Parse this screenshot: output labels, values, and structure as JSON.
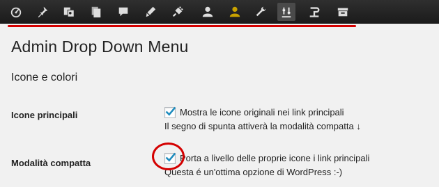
{
  "toolbar": {
    "icons": [
      "dashboard-icon",
      "pin-icon",
      "media-icon",
      "pages-icon",
      "comments-icon",
      "appearance-icon",
      "plugins-icon",
      "users-icon",
      "user-gold-icon",
      "tools-icon",
      "settings-icon",
      "arrow-return-icon",
      "archive-icon"
    ],
    "active_icon": "settings-icon",
    "accent_color": "#d40000",
    "gold_color": "#c9a200"
  },
  "page": {
    "title": "Admin Drop Down Menu",
    "section_title": "Icone e colori"
  },
  "settings": {
    "main_icons": {
      "label": "Icone principali",
      "option_text": "Mostra le icone originali nei link principali",
      "note": "Il segno di spunta attiverà la modalità compatta ↓",
      "checked": true
    },
    "compact_mode": {
      "label": "Modalità compatta",
      "option_text": "Porta a livello delle proprie icone i link principali",
      "note": "Questa é un'ottima opzione di WordPress :-)",
      "checked": true
    }
  }
}
